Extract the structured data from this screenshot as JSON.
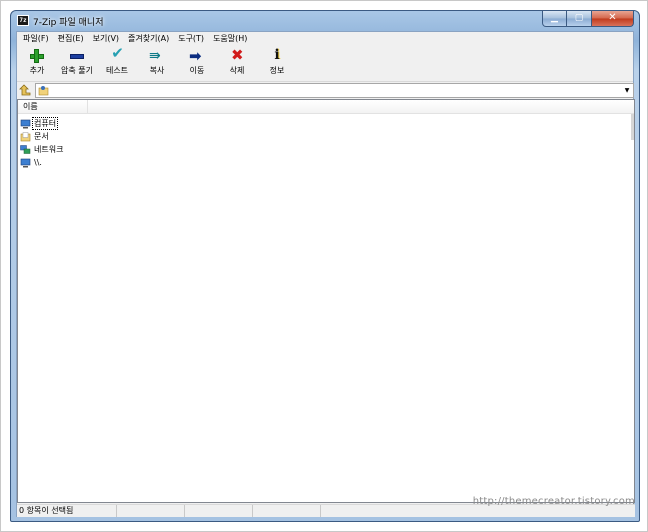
{
  "window": {
    "title": "7-Zip 파일 매니저",
    "app_icon_text": "7z",
    "min_glyph": "▁",
    "max_glyph": "▢",
    "close_glyph": "✕"
  },
  "menu": [
    {
      "label": "파일(F)"
    },
    {
      "label": "편집(E)"
    },
    {
      "label": "보기(V)"
    },
    {
      "label": "즐겨찾기(A)"
    },
    {
      "label": "도구(T)"
    },
    {
      "label": "도움말(H)"
    }
  ],
  "toolbar": {
    "add": "추가",
    "extract": "압축 풀기",
    "test": "테스트",
    "copy": "복사",
    "move": "이동",
    "delete": "삭제",
    "info": "정보"
  },
  "address": {
    "value": "",
    "dropdown_glyph": "▼"
  },
  "list": {
    "column_name": "이름",
    "items": [
      {
        "label": "컴퓨터",
        "icon": "computer-icon"
      },
      {
        "label": "문서",
        "icon": "documents-folder-icon"
      },
      {
        "label": "네트워크",
        "icon": "network-icon"
      },
      {
        "label": "\\\\.",
        "icon": "computer-icon"
      }
    ]
  },
  "status": {
    "selection": "0 항목이 선택됨",
    "cell2": "",
    "cell3": "",
    "cell4": ""
  },
  "watermark": "http://themecreator.tistory.com"
}
